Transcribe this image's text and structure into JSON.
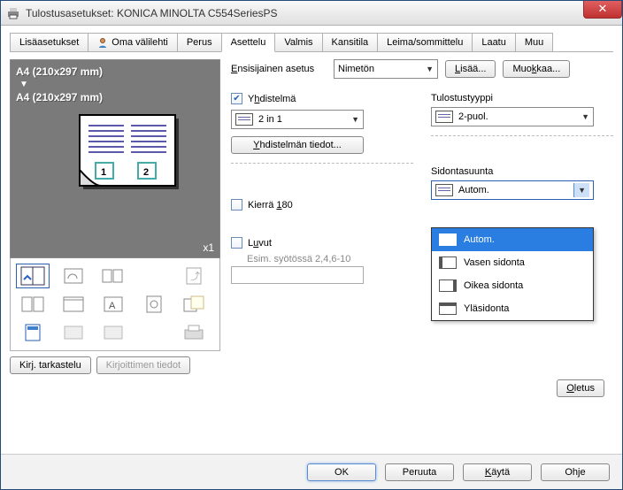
{
  "window": {
    "title": "Tulostusasetukset: KONICA MINOLTA C554SeriesPS"
  },
  "tabs": {
    "items": [
      {
        "label": "Lisäasetukset"
      },
      {
        "label": "Oma välilehti"
      },
      {
        "label": "Perus"
      },
      {
        "label": "Asettelu"
      },
      {
        "label": "Valmis"
      },
      {
        "label": "Kansitila"
      },
      {
        "label": "Leima/sommittelu"
      },
      {
        "label": "Laatu"
      },
      {
        "label": "Muu"
      }
    ]
  },
  "favorite": {
    "label": "Ensisijainen asetus",
    "selected": "Nimetön",
    "add": "Lisää...",
    "edit": "Muokkaa..."
  },
  "preview": {
    "src": "A4 (210x297 mm)",
    "dst": "A4 (210x297 mm)",
    "count": "x1"
  },
  "left_buttons": {
    "view": "Kirj. tarkastelu",
    "info": "Kirjoittimen tiedot"
  },
  "combine": {
    "label": "Yhdistelmä",
    "value": "2 in 1",
    "details": "Yhdistelmän tiedot..."
  },
  "rotate": {
    "label": "Kierrä 180"
  },
  "chapters": {
    "label": "Luvut",
    "hint": "Esim. syötössä 2,4,6-10",
    "value": ""
  },
  "printtype": {
    "label": "Tulostustyyppi",
    "value": "2-puol."
  },
  "binding": {
    "label": "Sidontasuunta",
    "value": "Autom.",
    "options": [
      {
        "label": "Autom."
      },
      {
        "label": "Vasen sidonta"
      },
      {
        "label": "Oikea sidonta"
      },
      {
        "label": "Yläsidonta"
      }
    ]
  },
  "default_btn": "Oletus",
  "footer": {
    "ok": "OK",
    "cancel": "Peruuta",
    "apply": "Käytä",
    "help": "Ohje"
  }
}
